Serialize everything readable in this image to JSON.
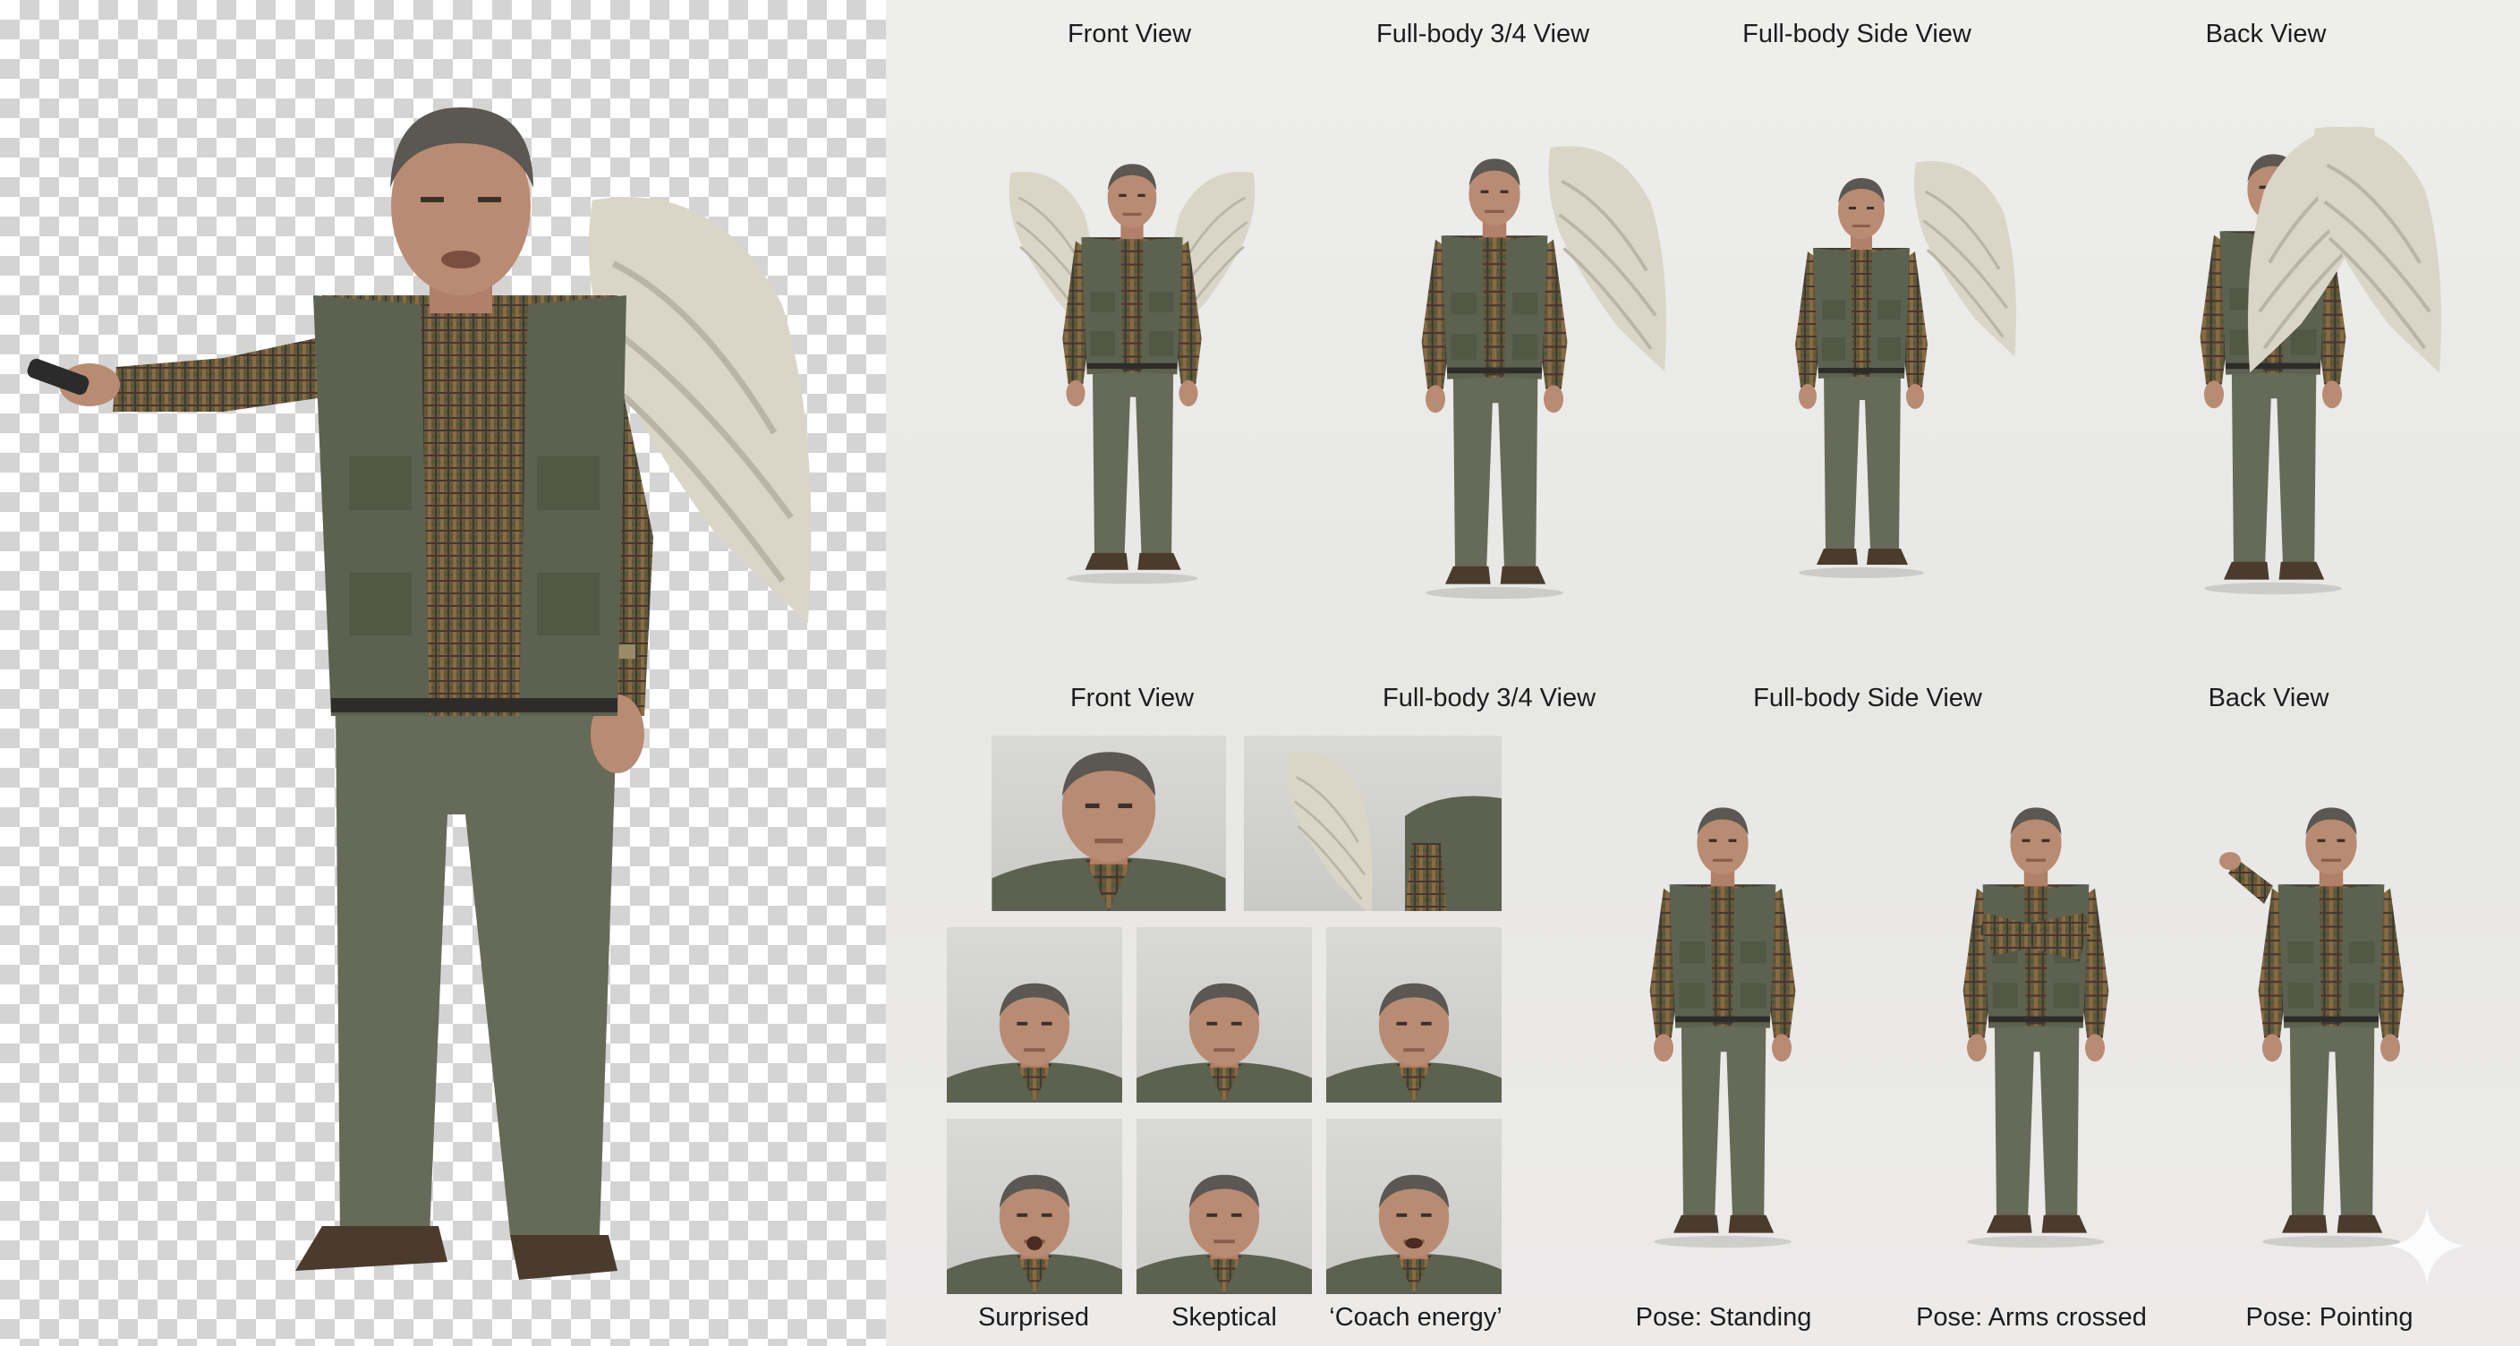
{
  "sheet": {
    "view_labels_top": [
      "Front View",
      "Full-body 3/4 View",
      "Full-body Side View",
      "Back View"
    ],
    "view_labels_mid": [
      "Front View",
      "Full-body 3/4 View",
      "Full-body Side View",
      "Back View"
    ],
    "expression_labels": [
      "Surprised",
      "Skeptical",
      "‘Coach energy’"
    ],
    "pose_labels": [
      "Pose: Standing",
      "Pose: Arms crossed",
      "Pose: Pointing"
    ]
  },
  "colors": {
    "vest": "#5d6250",
    "pants": "#666a58",
    "shirt_plaid": "#7a5a3c",
    "skin": "#b98b72",
    "hair": "#5b5752",
    "wing": "#d9d6c8",
    "boots": "#4a3b2c",
    "background_sheet": "#e8e8e6"
  },
  "icons": {
    "corner_mark": "sparkle-icon"
  }
}
